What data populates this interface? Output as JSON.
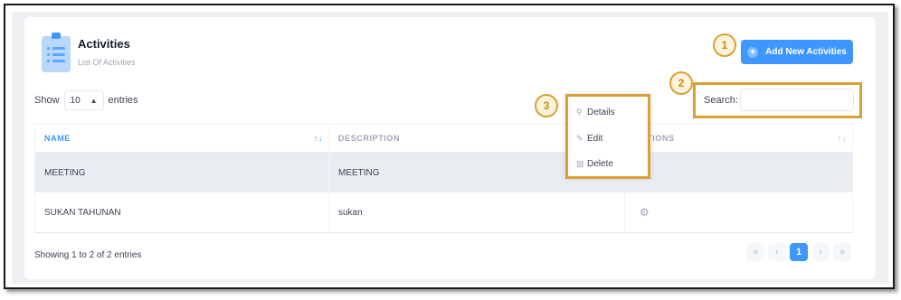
{
  "header": {
    "title": "Activities",
    "subtitle": "List Of Activities",
    "icon": "clipboard-list-icon",
    "add_button_label": "Add New Activities",
    "add_button_icon": "plus-circle-icon"
  },
  "callouts": [
    "1",
    "2",
    "3"
  ],
  "length_control": {
    "prefix": "Show",
    "value": "10",
    "suffix": "entries"
  },
  "search": {
    "label": "Search:",
    "value": "",
    "placeholder": ""
  },
  "table": {
    "columns": [
      "NAME",
      "DESCRIPTION",
      "ACTIONS"
    ],
    "rows": [
      {
        "name": "MEETING",
        "description": "MEETING"
      },
      {
        "name": "SUKAN TAHUNAN",
        "description": "sukan"
      }
    ]
  },
  "action_menu": {
    "items": [
      {
        "label": "Details",
        "icon": "search-icon"
      },
      {
        "label": "Edit",
        "icon": "edit-icon"
      },
      {
        "label": "Delete",
        "icon": "trash-icon"
      }
    ]
  },
  "footer": {
    "info": "Showing 1 to 2 of 2 entries"
  },
  "pagination": {
    "first": "«",
    "prev": "‹",
    "current": "1",
    "next": "›",
    "last": "»"
  },
  "colors": {
    "accent": "#3e97ff",
    "callout": "#d9a134",
    "selected_row": "#e9ecf1"
  }
}
